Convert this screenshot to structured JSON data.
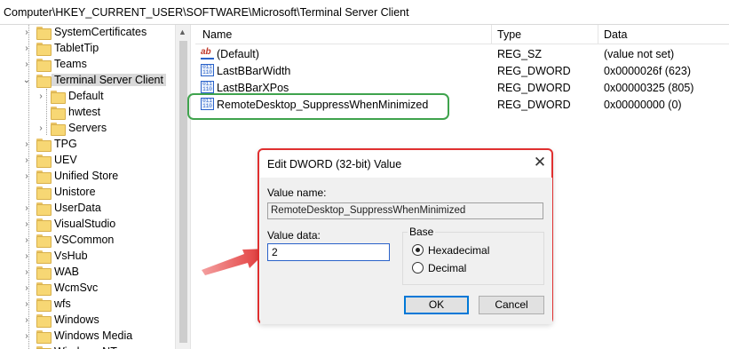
{
  "address": "Computer\\HKEY_CURRENT_USER\\SOFTWARE\\Microsoft\\Terminal Server Client",
  "tree": [
    {
      "label": "SystemCertificates",
      "level": 0,
      "expander": "right"
    },
    {
      "label": "TabletTip",
      "level": 0,
      "expander": "right"
    },
    {
      "label": "Teams",
      "level": 0,
      "expander": "right"
    },
    {
      "label": "Terminal Server Client",
      "level": 0,
      "expander": "down",
      "selected": true
    },
    {
      "label": "Default",
      "level": 1,
      "expander": "right"
    },
    {
      "label": "hwtest",
      "level": 1,
      "expander": "none"
    },
    {
      "label": "Servers",
      "level": 1,
      "expander": "right"
    },
    {
      "label": "TPG",
      "level": 0,
      "expander": "right"
    },
    {
      "label": "UEV",
      "level": 0,
      "expander": "right"
    },
    {
      "label": "Unified Store",
      "level": 0,
      "expander": "right"
    },
    {
      "label": "Unistore",
      "level": 0,
      "expander": "none"
    },
    {
      "label": "UserData",
      "level": 0,
      "expander": "right"
    },
    {
      "label": "VisualStudio",
      "level": 0,
      "expander": "right"
    },
    {
      "label": "VSCommon",
      "level": 0,
      "expander": "right"
    },
    {
      "label": "VsHub",
      "level": 0,
      "expander": "right"
    },
    {
      "label": "WAB",
      "level": 0,
      "expander": "right"
    },
    {
      "label": "WcmSvc",
      "level": 0,
      "expander": "right"
    },
    {
      "label": "wfs",
      "level": 0,
      "expander": "right"
    },
    {
      "label": "Windows",
      "level": 0,
      "expander": "right"
    },
    {
      "label": "Windows Media",
      "level": 0,
      "expander": "right"
    },
    {
      "label": "Windows NT",
      "level": 0,
      "expander": "right"
    }
  ],
  "columns": {
    "name": "Name",
    "type": "Type",
    "data": "Data"
  },
  "values": [
    {
      "name": "(Default)",
      "type": "REG_SZ",
      "data": "(value not set)",
      "icon": "string-value-icon"
    },
    {
      "name": "LastBBarWidth",
      "type": "REG_DWORD",
      "data": "0x0000026f (623)",
      "icon": "binary-value-icon"
    },
    {
      "name": "LastBBarXPos",
      "type": "REG_DWORD",
      "data": "0x00000325 (805)",
      "icon": "binary-value-icon"
    },
    {
      "name": "RemoteDesktop_SuppressWhenMinimized",
      "type": "REG_DWORD",
      "data": "0x00000000 (0)",
      "icon": "binary-value-icon",
      "highlighted": true
    }
  ],
  "dialog": {
    "title": "Edit DWORD (32-bit) Value",
    "value_name_label": "Value name:",
    "value_name": "RemoteDesktop_SuppressWhenMinimized",
    "value_data_label": "Value data:",
    "value_data": "2",
    "base_label": "Base",
    "base_options": [
      "Hexadecimal",
      "Decimal"
    ],
    "base_selected": "Hexadecimal",
    "ok_label": "OK",
    "cancel_label": "Cancel"
  },
  "colors": {
    "highlight_box": "#3fa34d",
    "dialog_outline": "#e03030",
    "arrow": "#e03030",
    "accent": "#0078d7"
  }
}
